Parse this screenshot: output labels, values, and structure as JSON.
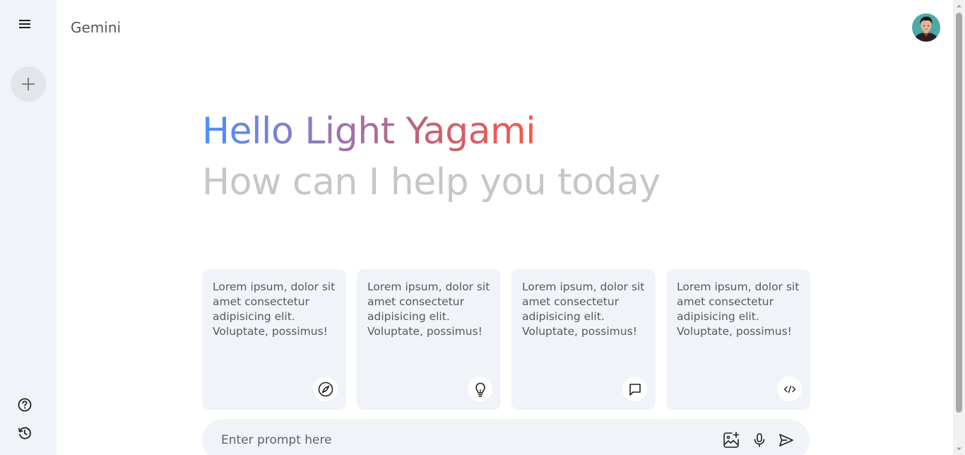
{
  "app": {
    "title": "Gemini"
  },
  "greeting": {
    "line1": "Hello Light Yagami",
    "line2": "How can I help you today",
    "gradient_colors": [
      "#4b90ff",
      "#8a7cc7",
      "#c0627a",
      "#ff5546"
    ]
  },
  "cards": [
    {
      "text": "Lorem ipsum, dolor sit amet consectetur adipisicing elit. Voluptate, possimus!",
      "icon": "compass-icon"
    },
    {
      "text": "Lorem ipsum, dolor sit amet consectetur adipisicing elit. Voluptate, possimus!",
      "icon": "bulb-icon"
    },
    {
      "text": "Lorem ipsum, dolor sit amet consectetur adipisicing elit. Voluptate, possimus!",
      "icon": "message-icon"
    },
    {
      "text": "Lorem ipsum, dolor sit amet consectetur adipisicing elit. Voluptate, possimus!",
      "icon": "code-icon"
    }
  ],
  "prompt": {
    "placeholder": "Enter prompt here",
    "value": ""
  },
  "sidebar": {
    "icons": [
      "menu-icon",
      "plus-icon",
      "help-icon",
      "history-icon"
    ]
  },
  "colors": {
    "sidebar_bg": "#f0f4f9",
    "card_bg": "#f0f4f9",
    "muted_text": "#c4c7c5"
  }
}
